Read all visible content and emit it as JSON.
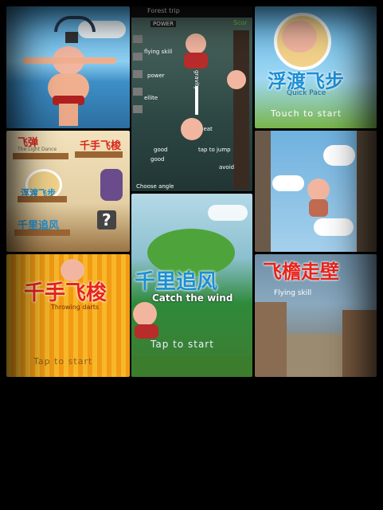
{
  "tiles": {
    "pig_jump": {},
    "forest_trip": {
      "header": "Forest trip",
      "score_label": "Scor",
      "power_badge": "POWER",
      "labels": [
        "flying skill",
        "power",
        "ellite",
        "gravity",
        "beat",
        "tap to jump",
        "good",
        "good",
        "avoid",
        "Choose angle"
      ]
    },
    "quick_pace": {
      "title_cn": "浮渡飞步",
      "subtitle": "Quick Pace",
      "touch": "Touch to start"
    },
    "menu": {
      "logo_top": "飞弹",
      "logo_top_sub": "The Light Dance",
      "item_darts": "千手飞梭",
      "item_wind": "千里追风",
      "item_quick": "浮渡飞步",
      "question": "?"
    },
    "cloud_city": {},
    "darts": {
      "title_cn": "千手飞梭",
      "subtitle": "Throwing darts",
      "tap": "Tap to start"
    },
    "wind": {
      "title_cn": "千里追风",
      "subtitle": "Catch the wind",
      "tap": "Tap to start"
    },
    "flying": {
      "title_cn": "飞檐走壁",
      "subtitle": "Flying skill"
    }
  },
  "colors": {
    "sky_blue": "#5fb6e8",
    "orange_yellow": "#f6a41d",
    "title_red": "#e8231b",
    "title_blue": "#1d8fd6",
    "title_green": "#33b84a"
  }
}
